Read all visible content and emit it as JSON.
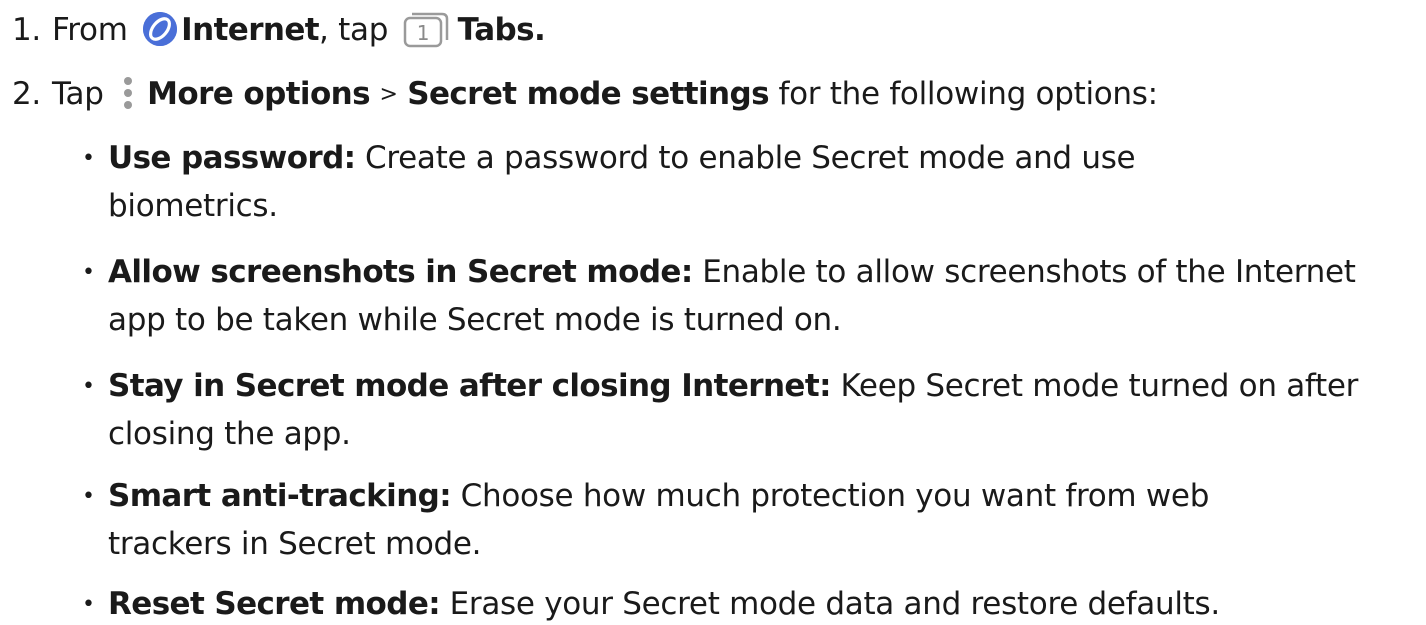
{
  "steps": [
    {
      "number": "1.",
      "t1": "From",
      "internet_label": "Internet",
      "t2": ", tap",
      "tabs_count": "1",
      "tabs_label": "Tabs."
    },
    {
      "number": "2.",
      "t1": "Tap",
      "more_options_label": "More options",
      "separator": ">",
      "settings_label": "Secret mode settings",
      "t2": "for the following options:"
    }
  ],
  "options": [
    {
      "title": "Use password:",
      "line1": "Create a password to enable Secret mode and use",
      "line2": "biometrics."
    },
    {
      "title": "Allow screenshots in Secret mode:",
      "line1": "Enable to allow screenshots of the Internet",
      "line2": "app to be taken while Secret mode is turned on."
    },
    {
      "title": "Stay in Secret mode after closing Internet:",
      "line1": "Keep Secret mode turned on after",
      "line2": "closing the app."
    },
    {
      "title": "Smart anti-tracking:",
      "line1": "Choose how much protection you want from web",
      "line2": "trackers in Secret mode."
    },
    {
      "title": "Reset Secret mode:",
      "line1": "Erase your Secret mode data and restore defaults.",
      "line2": ""
    }
  ],
  "bullet_glyph": "•",
  "icons": {
    "internet": "internet-app-icon",
    "tabs": "tabs-icon",
    "more": "more-options-icon"
  },
  "colors": {
    "internet_icon": "#4a6fd8",
    "tabs_icon_stroke": "#9a9a9a",
    "more_icon": "#9a9a9a"
  }
}
